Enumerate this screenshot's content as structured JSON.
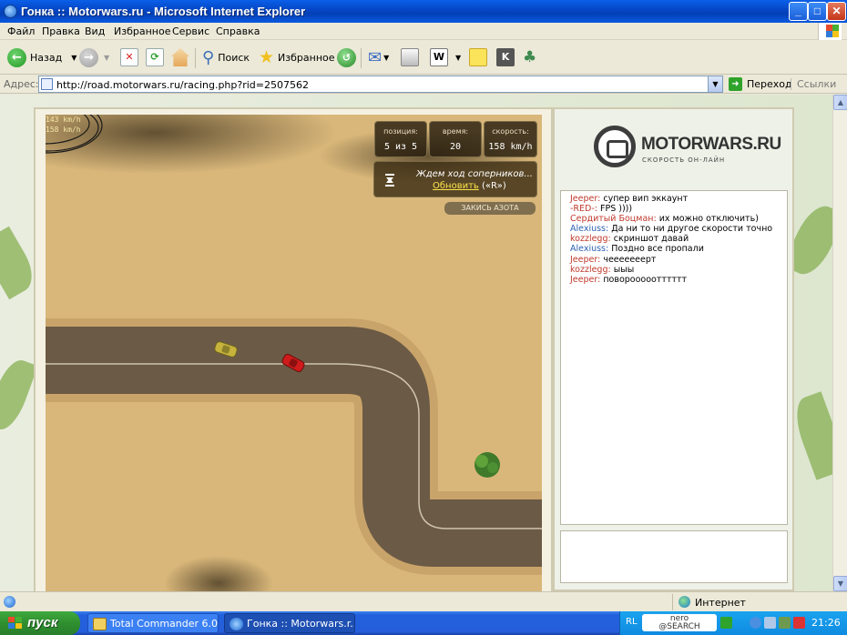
{
  "window": {
    "title": "Гонка :: Motorwars.ru - Microsoft Internet Explorer",
    "controls": {
      "minimize": "_",
      "maximize": "□",
      "close": "✕"
    }
  },
  "menu": [
    "Файл",
    "Правка",
    "Вид",
    "Избранное",
    "Сервис",
    "Справка"
  ],
  "toolbar": {
    "back_label": "Назад",
    "search_label": "Поиск",
    "favorites_label": "Избранное"
  },
  "address": {
    "label": "Адрес:",
    "url": "http://road.motorwars.ru/racing.php?rid=2507562",
    "go_label": "Переход",
    "links_label": "Ссылки"
  },
  "game": {
    "speed_overlay": [
      "143 km/h",
      "158 km/h"
    ],
    "hud": {
      "position_label": "позиция:",
      "position_value": "5 из 5",
      "time_label": "время:",
      "time_value": "20",
      "speed_label": "скорость:",
      "speed_value": "158 km/h"
    },
    "wait_text": "Ждем ход соперников...",
    "refresh_link": "Обновить",
    "refresh_key": "(«R»)",
    "nitro_button": "ЗАКИСЬ АЗОТА"
  },
  "site": {
    "logo_name": "MOTORWARS.RU",
    "logo_tagline": "СКОРОСТЬ ОН-ЛАЙН"
  },
  "chat": [
    {
      "user": "Jeeper:",
      "text": "супер вип эккаунт"
    },
    {
      "user": "-RED-:",
      "text": "FPS ))))"
    },
    {
      "user": "Сердитый Боцман:",
      "text": "их можно отключить)"
    },
    {
      "user": "Alexiuss:",
      "text": "Да ни то ни другое скорости точно"
    },
    {
      "user": "kozzlegg:",
      "text": "скриншот давай"
    },
    {
      "user": "Alexiuss:",
      "text": "Поздно все пропали"
    },
    {
      "user": "Jeeper:",
      "text": "чееееееерт"
    },
    {
      "user": "kozzlegg:",
      "text": "ыыы"
    },
    {
      "user": "Jeeper:",
      "text": "поворооооотттттт"
    }
  ],
  "status": {
    "zone": "Интернет"
  },
  "taskbar": {
    "start_label": "пуск",
    "tasks": [
      "Total Commander 6.0...",
      "Гонка :: Motorwars.r..."
    ],
    "lang": "RL",
    "nero_top": "nero",
    "nero_bottom": "@SEARCH",
    "clock": "21:26"
  },
  "colors": {
    "xp_blue": "#0548c8",
    "sand": "#d9b77a",
    "road": "#6b5a45",
    "chat_user": "#c0392b"
  }
}
